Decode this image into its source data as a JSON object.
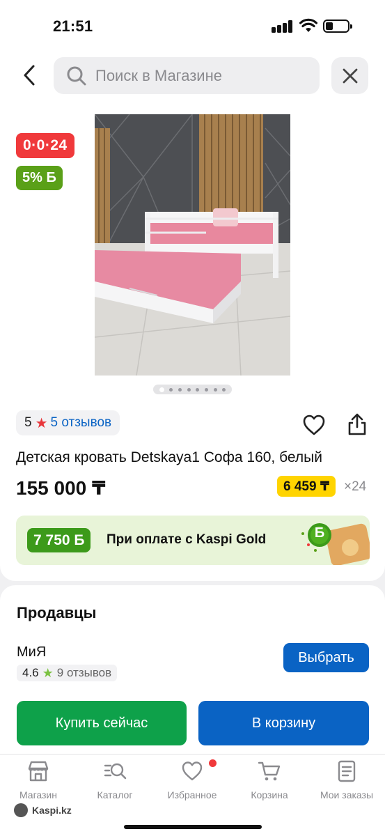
{
  "status_bar": {
    "time": "21:51"
  },
  "search": {
    "placeholder": "Поиск в Магазине"
  },
  "badges": {
    "installment": "0·0·24",
    "bonus": "5% Б"
  },
  "gallery": {
    "image_count": 8,
    "active_index": 0
  },
  "rating": {
    "score": "5",
    "reviews": "5 отзывов"
  },
  "product": {
    "title": "Детская кровать Detskaya1 Софа 160, белый",
    "price": "155 000 ₸",
    "monthly_price": "6 459 ₸",
    "months": "×24"
  },
  "kaspi_gold": {
    "bonus": "7 750 Б",
    "text": "При оплате с Kaspi Gold"
  },
  "sellers": {
    "title": "Продавцы",
    "name": "МиЯ",
    "rating": "4.6",
    "reviews": "9 отзывов",
    "choose_label": "Выбрать"
  },
  "actions": {
    "buy_now": "Купить сейчас",
    "add_to_cart": "В корзину"
  },
  "tabs": [
    {
      "label": "Магазин",
      "icon": "store-icon"
    },
    {
      "label": "Каталог",
      "icon": "catalog-search-icon"
    },
    {
      "label": "Избранное",
      "icon": "heart-icon"
    },
    {
      "label": "Корзина",
      "icon": "cart-icon"
    },
    {
      "label": "Мои заказы",
      "icon": "orders-icon"
    }
  ],
  "watermark": "Kaspi.kz",
  "colors": {
    "kaspi_red": "#f0393b",
    "kaspi_blue": "#0a63c4",
    "buy_green": "#0ea14a",
    "bonus_green": "#5aa018",
    "installment_yellow": "#ffd400"
  }
}
